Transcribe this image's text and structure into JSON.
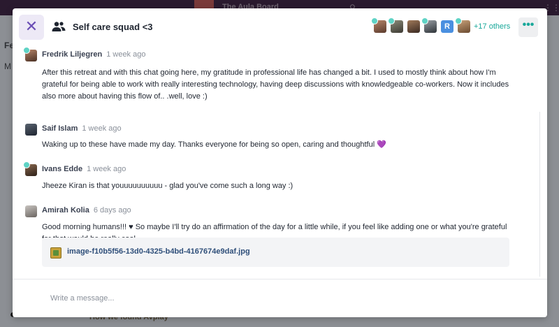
{
  "background": {
    "app_title": "The Aula Board",
    "sidebar_label_1": "Fe",
    "sidebar_label_2": "M",
    "bottom_text": "How we found Avplay"
  },
  "chat": {
    "title": "Self care squad <3",
    "others_label": "+17 others",
    "more_label": "•••",
    "close_label": "✕",
    "avatar_r_letter": "R"
  },
  "messages": [
    {
      "author": "Fredrik Liljegren",
      "time": "1 week ago",
      "text": "After this retreat and with this chat going here, my gratitude in professional life has changed a bit.  I used to mostly think about how I'm grateful for being able to work with really interesting technology, having deep discussions with knowledgeable co-workers. Now it includes also more about having this flow of.. .well, love :)"
    },
    {
      "author": "Saif Islam",
      "time": "1 week ago",
      "text": "Waking up to these have made my day. Thanks everyone for being so open, caring and thoughtful",
      "emoji": "💜"
    },
    {
      "author": "Ivans Edde",
      "time": "1 week ago",
      "text": "Jheeze Kiran is that youuuuuuuuuu - glad you've come such a long way :)"
    },
    {
      "author": "Amirah Kolia",
      "time": "6 days ago",
      "text": "Good morning humans!!! ♥ So maybe I'll try do an affirmation of the day for a little while, if you feel like adding one or what you're grateful for that would be really cool...",
      "attachment": "image-f10b5f56-13d0-4325-b4bd-4167674e9daf.jpg"
    }
  ],
  "composer": {
    "placeholder": "Write a message..."
  },
  "colors": {
    "accent": "#19a89a",
    "online_dot": "#5fd3c5",
    "close_bg": "#ede9f6",
    "close_fg": "#6a4db5"
  }
}
